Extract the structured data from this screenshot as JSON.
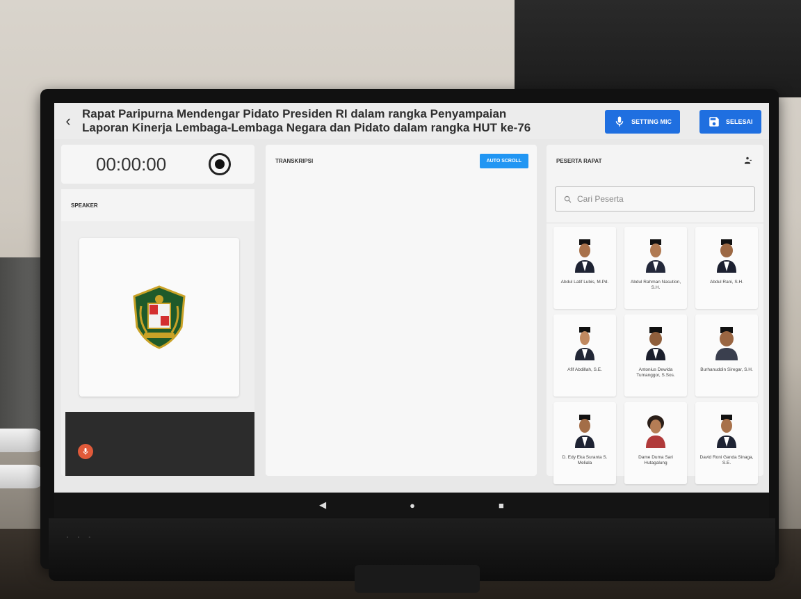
{
  "header": {
    "title_line1": "Rapat Paripurna Mendengar Pidato Presiden RI dalam rangka Penyampaian",
    "title_line2": "Laporan Kinerja Lembaga-Lembaga Negara dan Pidato dalam rangka HUT ke-76",
    "setting_mic_label": "SETTING MIC",
    "selesai_label": "SELESAI"
  },
  "recorder": {
    "timer": "00:00:00"
  },
  "speaker": {
    "heading": "SPEAKER"
  },
  "transcription": {
    "heading": "TRANSKRIPSI",
    "auto_scroll_label": "AUTO SCROLL"
  },
  "participants": {
    "heading": "PESERTA RAPAT",
    "search_placeholder": "Cari Peserta",
    "items": [
      {
        "name": "Abdul Latif Lubis, M.Pd."
      },
      {
        "name": "Abdul Rahman Nasution, S.H."
      },
      {
        "name": "Abdul Rani, S.H."
      },
      {
        "name": "Afif Abdillah, S.E."
      },
      {
        "name": "Antonius Dewida Tumanggor, S.Sos."
      },
      {
        "name": "Burhanuddin Siregar, S.H."
      },
      {
        "name": "D. Edy Eka Suranta S. Meliala"
      },
      {
        "name": "Dame Duma Sari Hutagalung"
      },
      {
        "name": "David Roni Ganda Sinaga, S.E."
      }
    ]
  },
  "colors": {
    "primary_button": "#1f6fe0",
    "auto_scroll": "#2196f3",
    "mic_dot": "#e05a3a"
  },
  "navbar": {
    "back": "◀",
    "home": "●",
    "recent": "■"
  }
}
